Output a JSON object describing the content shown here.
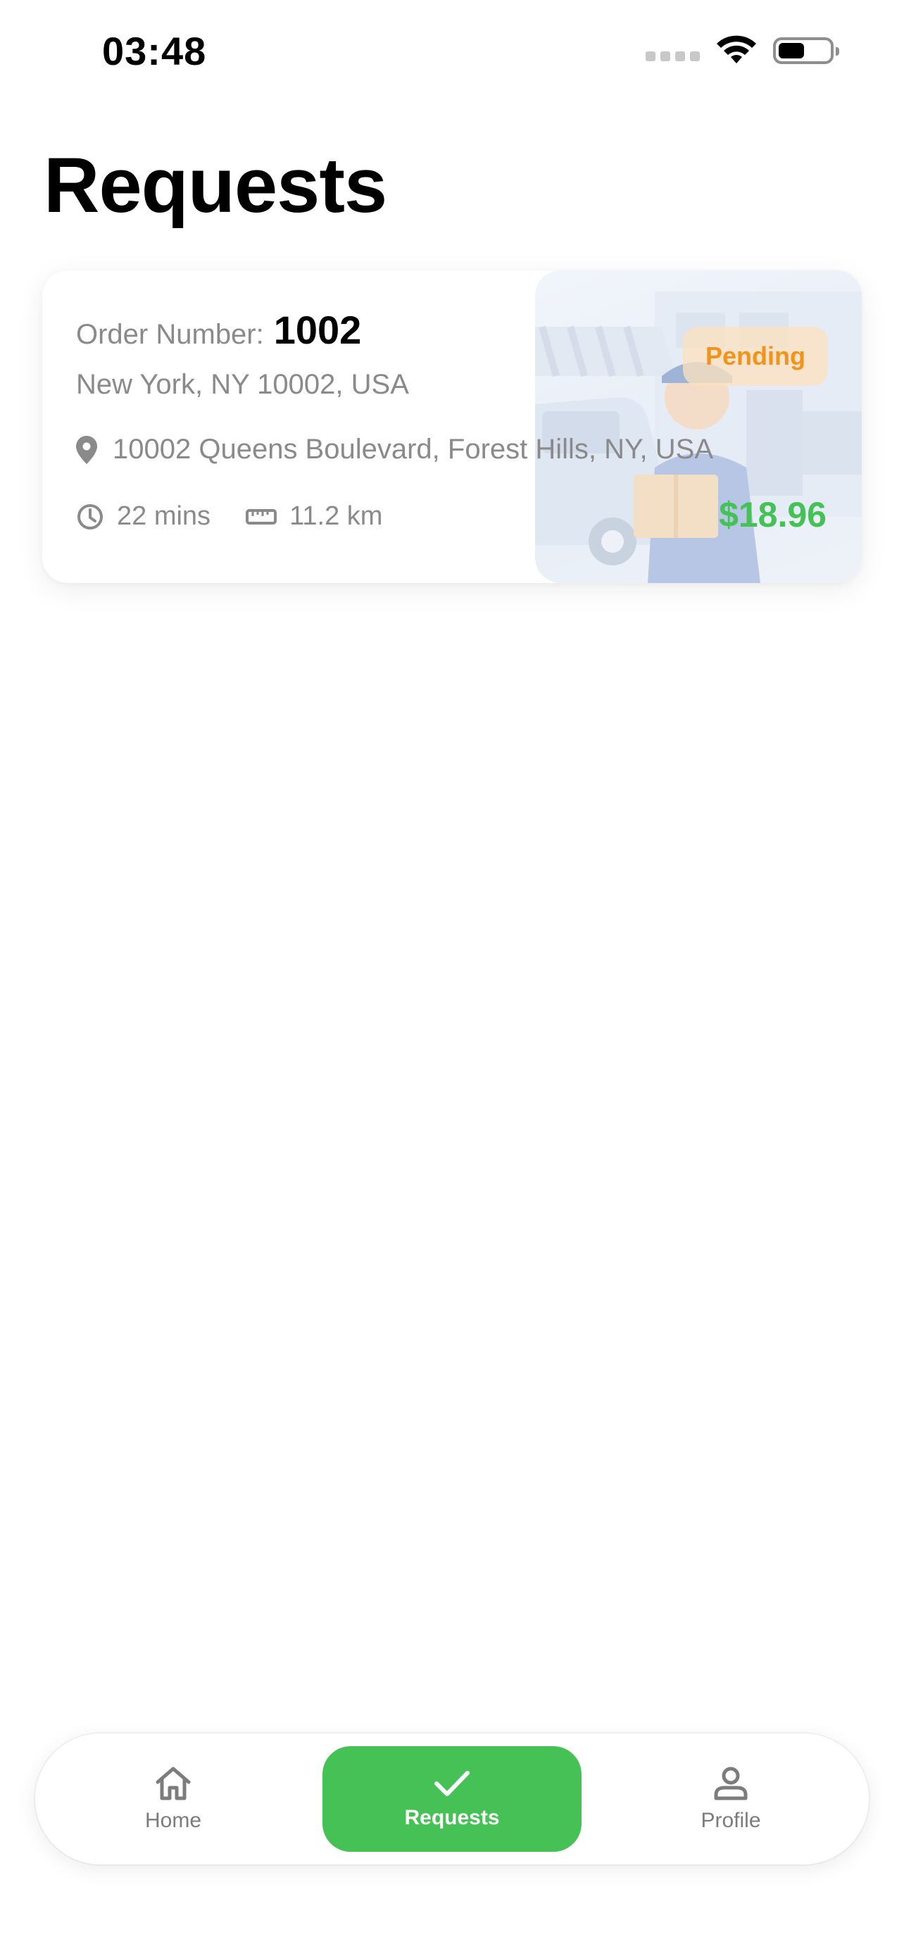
{
  "status_bar": {
    "time": "03:48"
  },
  "page": {
    "title": "Requests"
  },
  "requests": [
    {
      "order_label": "Order Number:",
      "order_number": "1002",
      "city": "New York, NY 10002, USA",
      "address": "10002 Queens Boulevard, Forest Hills, NY, USA",
      "duration": "22 mins",
      "distance": "11.2 km",
      "status": "Pending",
      "price": "$18.96"
    }
  ],
  "tab_bar": {
    "home_label": "Home",
    "requests_label": "Requests",
    "profile_label": "Profile",
    "active": "requests"
  },
  "icons": {
    "pin": "location-pin-icon",
    "clock": "clock-icon",
    "distance": "ruler-icon",
    "home": "home-icon",
    "requests": "checkmark-icon",
    "profile": "person-icon"
  },
  "colors": {
    "accent": "#45c155",
    "pending_text": "#f2941c",
    "pending_bg": "#fde2bd",
    "muted_text": "#8a8a8a"
  }
}
